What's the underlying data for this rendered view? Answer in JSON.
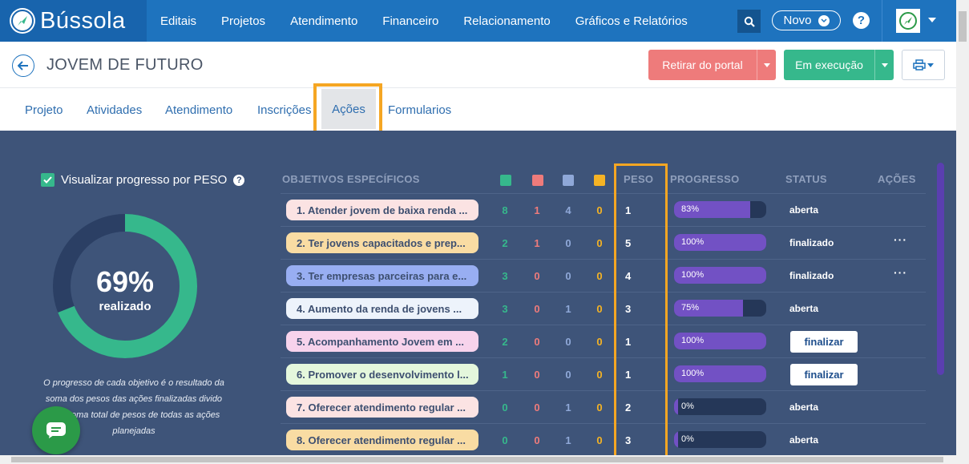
{
  "app": {
    "brand": "Bússola"
  },
  "nav": {
    "items": [
      "Editais",
      "Projetos",
      "Atendimento",
      "Financeiro",
      "Relacionamento",
      "Gráficos e Relatórios"
    ]
  },
  "header_actions": {
    "novo_label": "Novo",
    "help_label": "?"
  },
  "page": {
    "title": "JOVEM DE FUTURO",
    "retirar_label": "Retirar do portal",
    "execucao_label": "Em execução"
  },
  "tabs": [
    "Projeto",
    "Atividades",
    "Atendimento",
    "Inscrições",
    "Ações",
    "Formularios"
  ],
  "active_tab": "Ações",
  "dashboard": {
    "checkbox_label": "Visualizar progresso por PESO",
    "progress_value": 69,
    "progress_text": "69%",
    "progress_sub": "realizado",
    "note": "O progresso de cada objetivo é o resultado da soma dos pesos das ações finalizadas divido pela soma total de pesos de todas as ações planejadas",
    "colors": {
      "green": "#36b88c",
      "red": "#ee7b7b",
      "blue": "#8fa8d8",
      "orange": "#f5b324"
    }
  },
  "table": {
    "headers": {
      "objetivos": "OBJETIVOS ESPECÍFICOS",
      "peso": "PESO",
      "progresso": "PROGRESSO",
      "status": "STATUS",
      "acoes": "AÇÕES"
    },
    "rows": [
      {
        "label": "1. Atender jovem de baixa renda ...",
        "pill": "#fbe3e3",
        "c1": "8",
        "c2": "1",
        "c3": "4",
        "c4": "0",
        "peso": "1",
        "progress": 83,
        "progress_text": "83%",
        "status": "aberta",
        "finalizar": "",
        "menu": ""
      },
      {
        "label": "2. Ter jovens capacitados e prep...",
        "pill": "#f9dca3",
        "c1": "2",
        "c2": "1",
        "c3": "0",
        "c4": "0",
        "peso": "5",
        "progress": 100,
        "progress_text": "100%",
        "status": "finalizado",
        "finalizar": "",
        "menu": "···"
      },
      {
        "label": "3. Ter empresas parceiras para e...",
        "pill": "#98aef2",
        "c1": "3",
        "c2": "0",
        "c3": "0",
        "c4": "0",
        "peso": "4",
        "progress": 100,
        "progress_text": "100%",
        "status": "finalizado",
        "finalizar": "",
        "menu": "···"
      },
      {
        "label": "4. Aumento da renda de jovens ...",
        "pill": "#edf3fb",
        "c1": "3",
        "c2": "0",
        "c3": "1",
        "c4": "0",
        "peso": "3",
        "progress": 75,
        "progress_text": "75%",
        "status": "aberta",
        "finalizar": "",
        "menu": ""
      },
      {
        "label": "5. Acompanhamento Jovem em ...",
        "pill": "#f7d3ec",
        "c1": "2",
        "c2": "0",
        "c3": "0",
        "c4": "0",
        "peso": "1",
        "progress": 100,
        "progress_text": "100%",
        "status": "",
        "finalizar": "finalizar",
        "menu": ""
      },
      {
        "label": "6. Promover o desenvolvimento l...",
        "pill": "#e4f7dc",
        "c1": "1",
        "c2": "0",
        "c3": "0",
        "c4": "0",
        "peso": "1",
        "progress": 100,
        "progress_text": "100%",
        "status": "",
        "finalizar": "finalizar",
        "menu": ""
      },
      {
        "label": "7. Oferecer atendimento regular ...",
        "pill": "#fbe3e3",
        "c1": "0",
        "c2": "0",
        "c3": "1",
        "c4": "0",
        "peso": "2",
        "progress": 0,
        "progress_text": "0%",
        "status": "aberta",
        "finalizar": "",
        "menu": ""
      },
      {
        "label": "8. Oferecer atendimento regular ...",
        "pill": "#f9dca3",
        "c1": "0",
        "c2": "0",
        "c3": "1",
        "c4": "0",
        "peso": "3",
        "progress": 0,
        "progress_text": "0%",
        "status": "aberta",
        "finalizar": "",
        "menu": ""
      }
    ]
  }
}
